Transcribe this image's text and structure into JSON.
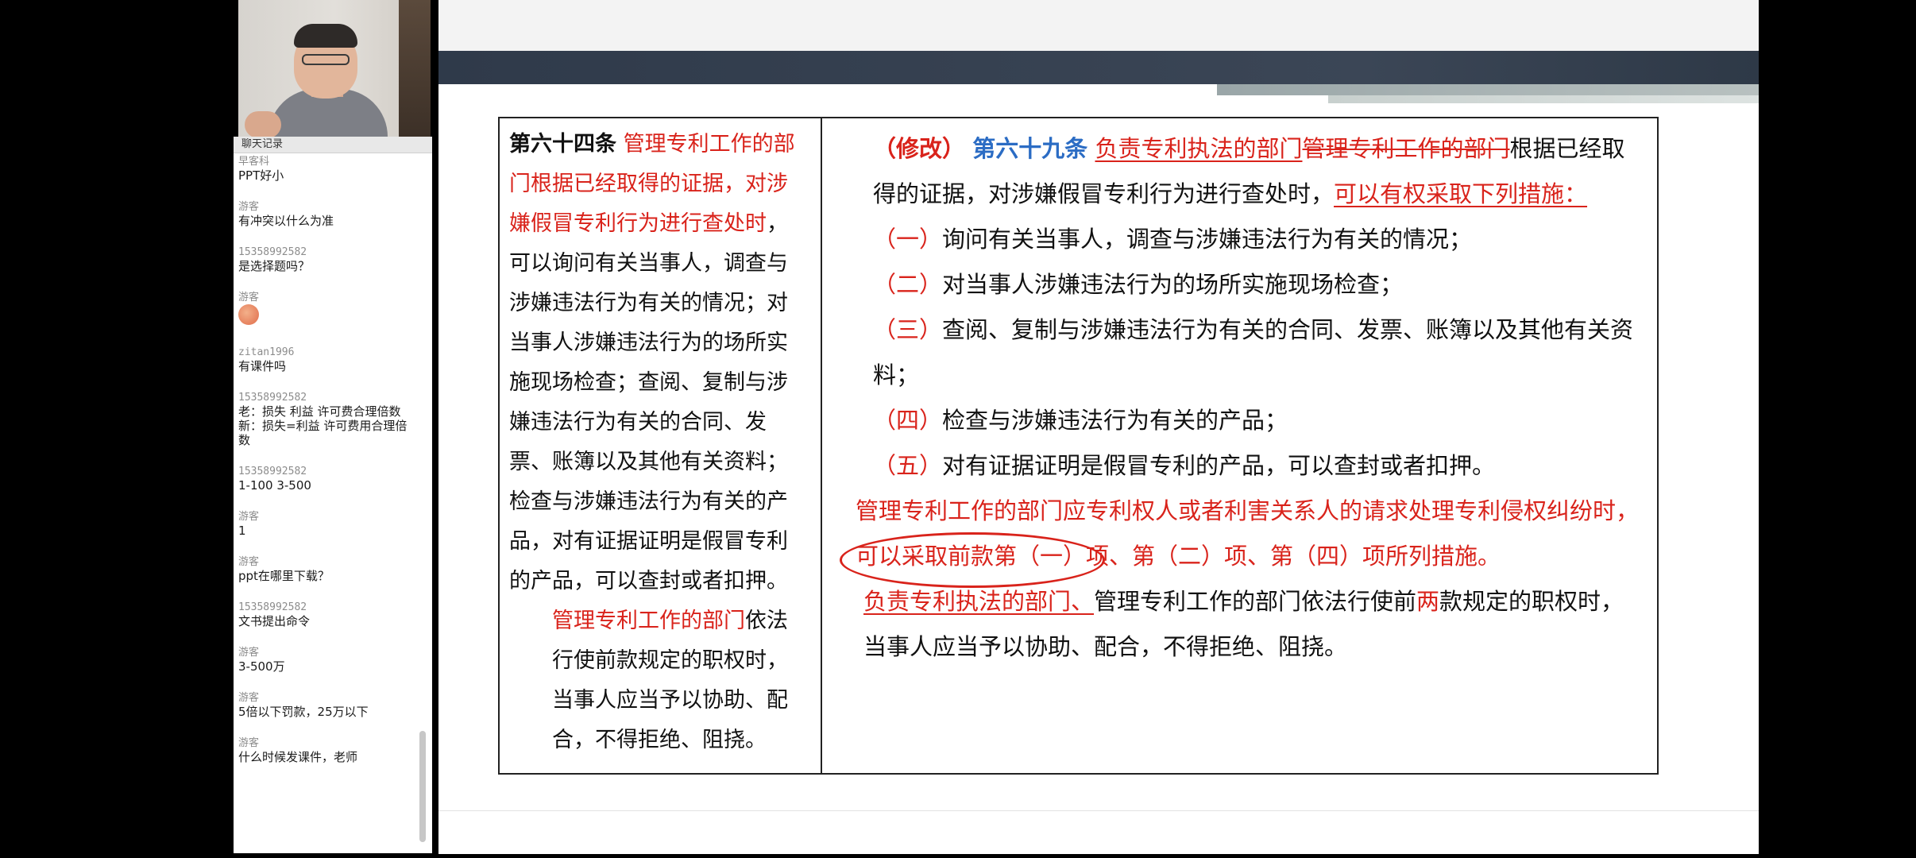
{
  "chat": {
    "header": "聊天记录",
    "messages": [
      {
        "sender": "早客科",
        "text": "PPT好小"
      },
      {
        "sender": "游客",
        "text": "有冲突以什么为准"
      },
      {
        "sender": "15358992582",
        "text": "是选择题吗？"
      },
      {
        "sender": "游客",
        "text": ""
      },
      {
        "sender": "zitan1996",
        "text": "有课件吗"
      },
      {
        "sender": "15358992582",
        "text": "老：损失 利益 许可费合理倍数 新：损失=利益 许可费用合理倍数"
      },
      {
        "sender": "15358992582",
        "text": "1-100 3-500"
      },
      {
        "sender": "游客",
        "text": "1"
      },
      {
        "sender": "游客",
        "text": "ppt在哪里下载？"
      },
      {
        "sender": "15358992582",
        "text": "文书提出命令"
      },
      {
        "sender": "游客",
        "text": "3-500万"
      },
      {
        "sender": "游客",
        "text": "5倍以下罚款，25万以下"
      },
      {
        "sender": "游客",
        "text": "什么时候发课件，老师"
      }
    ]
  },
  "slide": {
    "left": {
      "article": "第六十四条",
      "red_intro": "管理专利工作的部门根据已经取得的证据，对涉嫌假冒专利行为进行查处时",
      "body": "，可以询问有关当事人，调查与涉嫌违法行为有关的情况；对当事人涉嫌违法行为的场所实施现场检查；查阅、复制与涉嫌违法行为有关的合同、发票、账簿以及其他有关资料；检查与涉嫌违法行为有关的产品，对有证据证明是假冒专利的产品，可以查封或者扣押。",
      "p2_red": "管理专利工作的部门",
      "p2_body": "依法行使前款规定的职权时，当事人应当予以协助、配合，不得拒绝、阻挠。"
    },
    "right": {
      "tag": "（修改）",
      "article": "第六十九条",
      "red_new": "负责专利执法的部门",
      "red_old": "管理专利工作的部门",
      "p1_body": "根据已经取得的证据，对涉嫌假冒专利行为进行查处时，",
      "p1_red": "可以有权采取下列措施：",
      "items": [
        {
          "num": "（一）",
          "text": "询问有关当事人，调查与涉嫌违法行为有关的情况；"
        },
        {
          "num": "（二）",
          "text": "对当事人涉嫌违法行为的场所实施现场检查；"
        },
        {
          "num": "（三）",
          "text": "查阅、复制与涉嫌违法行为有关的合同、发票、账簿以及其他有关资料；"
        },
        {
          "num": "（四）",
          "text": "检查与涉嫌违法行为有关的产品；"
        },
        {
          "num": "（五）",
          "text": "对有证据证明是假冒专利的产品，可以查封或者扣押。"
        }
      ],
      "p2_red": "管理专利工作的部门应专利权人或者利害关系人的请求处理专利侵权纠纷时，可以采取前款第（一）项、第（二）项、第（四）项所列措施。",
      "p3_red": "负责专利执法的部门、",
      "p3_body_a": "管理专利工作的部门依法行使前",
      "p3_red2": "两",
      "p3_body_b": "款规定的职权时，当事人应当予以协助、配合，不得拒绝、阻挠。"
    }
  }
}
